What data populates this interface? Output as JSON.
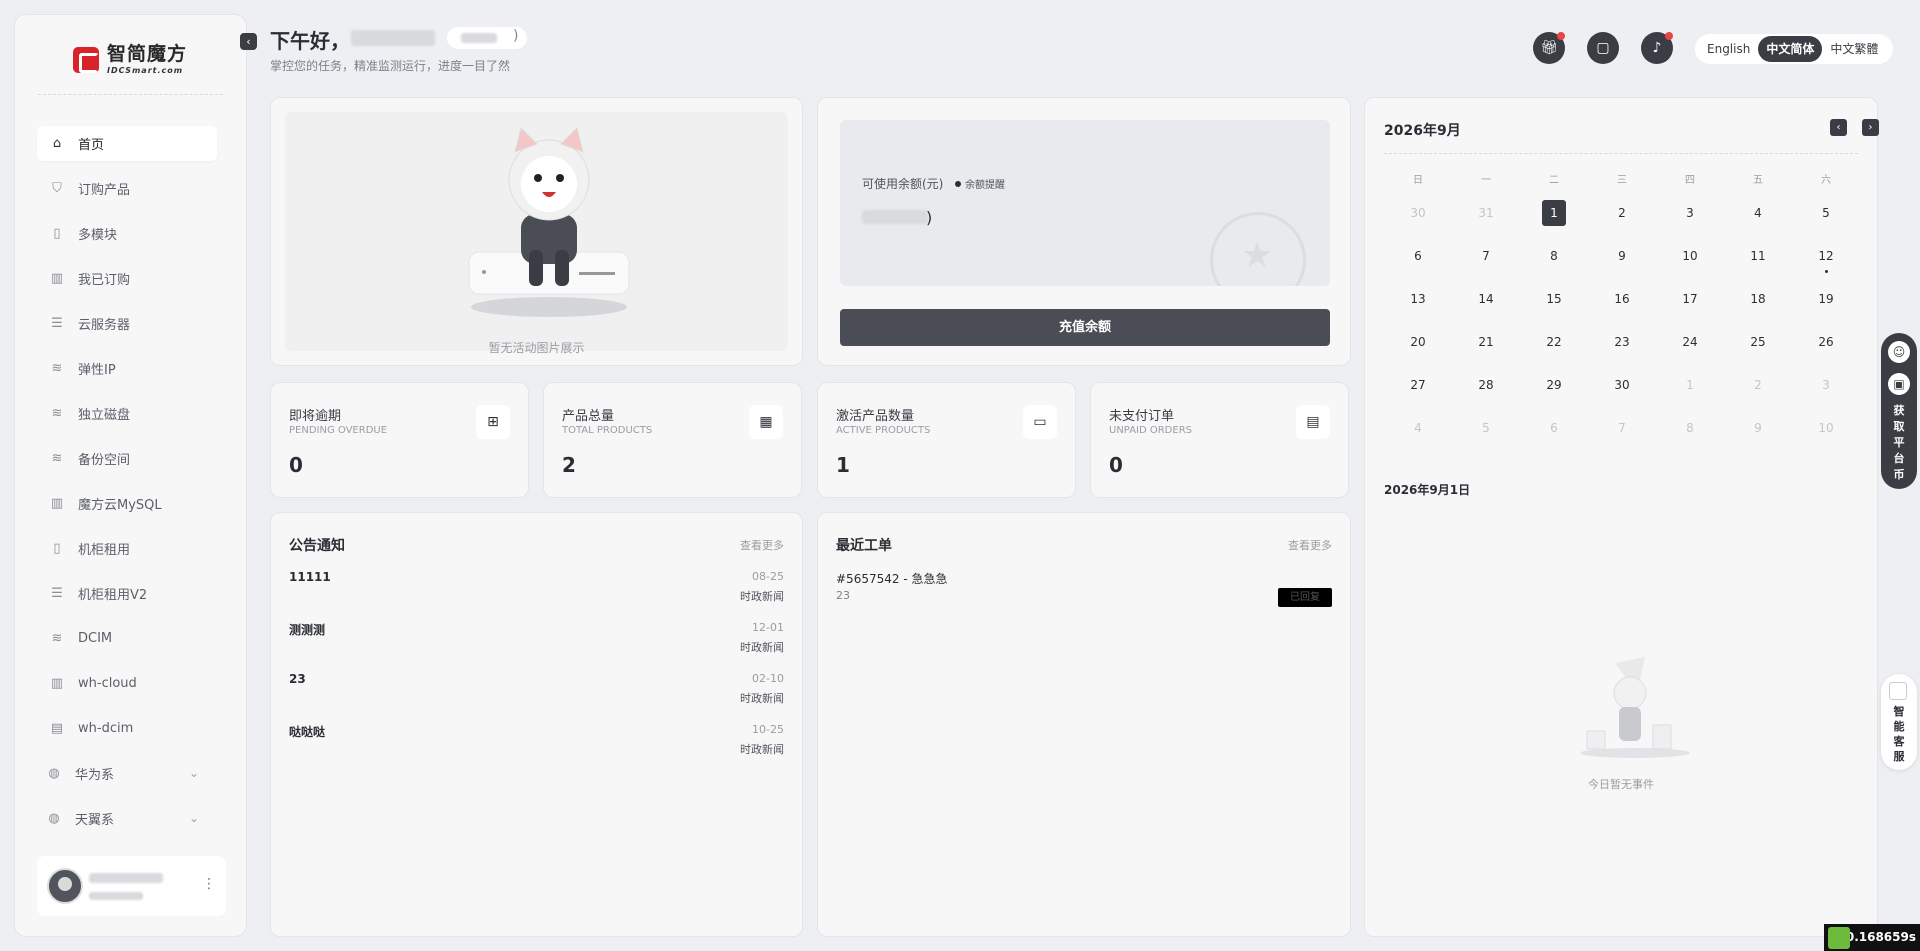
{
  "brand": {
    "name_cn": "智简魔方",
    "name_en": "IDCSmart.com"
  },
  "header": {
    "greeting": "下午好，",
    "greeting_suffix": ")",
    "subtitle": "掌控您的任务，精准监测运行，进度一目了然",
    "languages": [
      "English",
      "中文简体",
      "中文繁體"
    ],
    "active_language": "中文简体"
  },
  "sidebar": {
    "items": [
      {
        "label": "首页",
        "icon": "home-icon"
      },
      {
        "label": "订购产品",
        "icon": "cart-icon"
      },
      {
        "label": "多模块",
        "icon": "module-icon"
      },
      {
        "label": "我已订购",
        "icon": "chart-icon"
      },
      {
        "label": "云服务器",
        "icon": "server-icon"
      },
      {
        "label": "弹性IP",
        "icon": "database-icon"
      },
      {
        "label": "独立磁盘",
        "icon": "database-icon"
      },
      {
        "label": "备份空间",
        "icon": "database-icon"
      },
      {
        "label": "魔方云MySQL",
        "icon": "chart-icon"
      },
      {
        "label": "机柜租用",
        "icon": "module-icon"
      },
      {
        "label": "机柜租用V2",
        "icon": "server-icon"
      },
      {
        "label": "DCIM",
        "icon": "database-icon"
      },
      {
        "label": "wh-cloud",
        "icon": "chart-icon"
      },
      {
        "label": "wh-dcim",
        "icon": "list-icon"
      }
    ],
    "groups": [
      {
        "label": "华为系",
        "icon": "globe-icon"
      },
      {
        "label": "天翼系",
        "icon": "globe-icon"
      }
    ]
  },
  "banner": {
    "caption": "暂无活动图片展示"
  },
  "balance": {
    "label": "可使用余额(元)",
    "tip": "余额提醒",
    "value_suffix": ")",
    "recharge_label": "充值余额"
  },
  "stats": [
    {
      "title": "即将逾期",
      "subtitle": "PENDING OVERDUE",
      "value": "0",
      "icon": "bookmark-icon"
    },
    {
      "title": "产品总量",
      "subtitle": "TOTAL PRODUCTS",
      "value": "2",
      "icon": "grid-icon"
    },
    {
      "title": "激活产品数量",
      "subtitle": "ACTIVE PRODUCTS",
      "value": "1",
      "icon": "inbox-icon"
    },
    {
      "title": "未支付订单",
      "subtitle": "UNPAID ORDERS",
      "value": "0",
      "icon": "document-icon"
    }
  ],
  "notices": {
    "title": "公告通知",
    "more": "查看更多",
    "items": [
      {
        "title": "11111",
        "date": "08-25",
        "category": "时政新闻"
      },
      {
        "title": "测测测",
        "date": "12-01",
        "category": "时政新闻"
      },
      {
        "title": "23",
        "date": "02-10",
        "category": "时政新闻"
      },
      {
        "title": "哒哒哒",
        "date": "10-25",
        "category": "时政新闻"
      }
    ]
  },
  "tickets": {
    "title": "最近工单",
    "more": "查看更多",
    "items": [
      {
        "title": "#5657542 - 急急急",
        "subtitle": "23",
        "status": "已回复"
      }
    ]
  },
  "calendar": {
    "title": "2026年9月",
    "weekdays": [
      "日",
      "一",
      "二",
      "三",
      "四",
      "五",
      "六"
    ],
    "weeks": [
      [
        {
          "d": "30",
          "dim": true
        },
        {
          "d": "31",
          "dim": true
        },
        {
          "d": "1",
          "sel": true
        },
        {
          "d": "2"
        },
        {
          "d": "3"
        },
        {
          "d": "4"
        },
        {
          "d": "5"
        }
      ],
      [
        {
          "d": "6"
        },
        {
          "d": "7"
        },
        {
          "d": "8"
        },
        {
          "d": "9"
        },
        {
          "d": "10"
        },
        {
          "d": "11"
        },
        {
          "d": "12",
          "dot": true
        }
      ],
      [
        {
          "d": "13"
        },
        {
          "d": "14"
        },
        {
          "d": "15"
        },
        {
          "d": "16"
        },
        {
          "d": "17"
        },
        {
          "d": "18"
        },
        {
          "d": "19"
        }
      ],
      [
        {
          "d": "20"
        },
        {
          "d": "21"
        },
        {
          "d": "22"
        },
        {
          "d": "23"
        },
        {
          "d": "24"
        },
        {
          "d": "25"
        },
        {
          "d": "26"
        }
      ],
      [
        {
          "d": "27"
        },
        {
          "d": "28"
        },
        {
          "d": "29"
        },
        {
          "d": "30"
        },
        {
          "d": "1",
          "dim": true
        },
        {
          "d": "2",
          "dim": true
        },
        {
          "d": "3",
          "dim": true
        }
      ],
      [
        {
          "d": "4",
          "dim": true
        },
        {
          "d": "5",
          "dim": true
        },
        {
          "d": "6",
          "dim": true
        },
        {
          "d": "7",
          "dim": true
        },
        {
          "d": "8",
          "dim": true
        },
        {
          "d": "9",
          "dim": true
        },
        {
          "d": "10",
          "dim": true
        }
      ]
    ],
    "selected_date": "2026年9月1日",
    "empty_caption": "今日暂无事件"
  },
  "float_bar": {
    "text": "获取平台币"
  },
  "service": {
    "text": "智能客服"
  },
  "timer": "0.168659s",
  "colors": {
    "accent": "#3a3d44",
    "notify_dot": "#e84545",
    "brand_red": "#d8232a"
  }
}
